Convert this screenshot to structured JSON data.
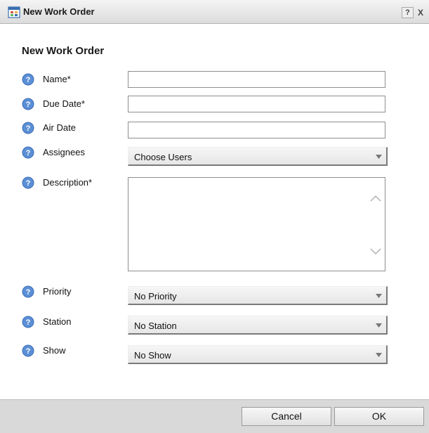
{
  "window": {
    "title": "New Work Order",
    "help_label": "?",
    "close_label": "X"
  },
  "form": {
    "heading": "New Work Order",
    "fields": {
      "name": {
        "label": "Name*",
        "value": ""
      },
      "due_date": {
        "label": "Due Date*",
        "value": ""
      },
      "air_date": {
        "label": "Air Date",
        "value": ""
      },
      "assignees": {
        "label": "Assignees",
        "selected": "Choose Users"
      },
      "description": {
        "label": "Description*",
        "value": ""
      },
      "priority": {
        "label": "Priority",
        "selected": "No Priority"
      },
      "station": {
        "label": "Station",
        "selected": "No Station"
      },
      "show": {
        "label": "Show",
        "selected": "No Show"
      }
    }
  },
  "footer": {
    "cancel_label": "Cancel",
    "ok_label": "OK"
  },
  "icons": {
    "help": "question-circle-icon",
    "title": "work-order-icon",
    "dropdown": "chevron-down-icon"
  },
  "colors": {
    "help_icon_fill": "#5b8fd6",
    "footer_bg": "#d9d9d9"
  }
}
